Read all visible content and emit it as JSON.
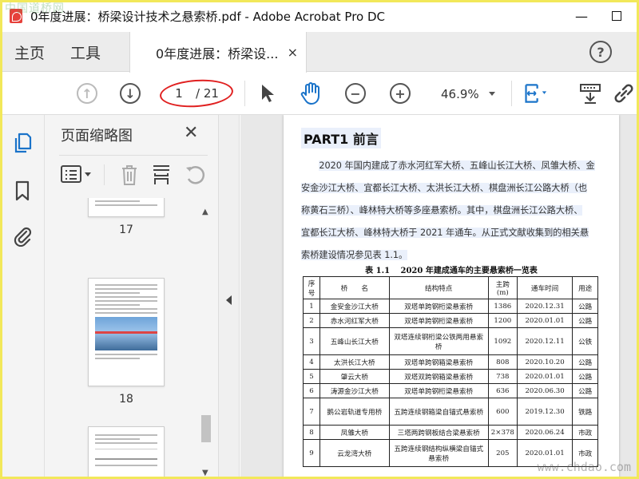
{
  "window": {
    "title": "0年度进展：桥梁设计技术之悬索桥.pdf - Adobe Acrobat Pro DC",
    "minimize": "—",
    "close": "✕"
  },
  "watermarks": {
    "top_left": "中国道桥网",
    "bottom_right": "www.chdao.com"
  },
  "tabs": {
    "home": "主页",
    "tools": "工具",
    "document": "0年度进展：桥梁设...",
    "close": "×",
    "help": "?"
  },
  "toolbar": {
    "page_current": "1",
    "page_total": "/ 21",
    "zoom": "46.9%"
  },
  "panel": {
    "title": "页面缩略图",
    "close": "✕",
    "thumbnails": [
      {
        "label": "17"
      },
      {
        "label": "18"
      }
    ]
  },
  "document": {
    "heading": "PART1 前言",
    "paragraph_lines": [
      "2020 年国内建成了赤水河红军大桥、五峰山长江大桥、凤雏大桥、金",
      "安金沙江大桥、宜都长江大桥、太洪长江大桥、棋盘洲长江公路大桥（也",
      "称黄石三桥）、峰林特大桥等多座悬索桥。其中，棋盘洲长江公路大桥、",
      "宜都长江大桥、峰林特大桥于 2021 年通车。从正式文献收集到的相关悬",
      "索桥建设情况参见表 1.1。"
    ],
    "table_caption": "表 1.1　 2020 年建成通车的主要悬索桥一览表",
    "table_headers": [
      "序号",
      "桥　　名",
      "结构特点",
      "主跨(m)",
      "通车时间",
      "用途"
    ],
    "table_rows": [
      [
        "1",
        "金安金沙江大桥",
        "双塔单跨钢桁梁悬索桥",
        "1386",
        "2020.12.31",
        "公路"
      ],
      [
        "2",
        "赤水河红军大桥",
        "双塔单跨钢桁梁悬索桥",
        "1200",
        "2020.01.01",
        "公路"
      ],
      [
        "3",
        "五峰山长江大桥",
        "双塔连续钢桁梁公铁两用悬索桥",
        "1092",
        "2020.12.11",
        "公铁"
      ],
      [
        "4",
        "太洪长江大桥",
        "双塔单跨钢箱梁悬索桥",
        "808",
        "2020.10.20",
        "公路"
      ],
      [
        "5",
        "肇云大桥",
        "双塔双跨钢箱梁悬索桥",
        "738",
        "2020.01.01",
        "公路"
      ],
      [
        "6",
        "涛源金沙江大桥",
        "双塔单跨钢桁梁悬索桥",
        "636",
        "2020.06.30",
        "公路"
      ],
      [
        "7",
        "鹅公岩轨道专用桥",
        "五跨连续钢箱梁自锚式悬索桥",
        "600",
        "2019.12.30",
        "铁路"
      ],
      [
        "8",
        "凤雏大桥",
        "三塔两跨钢板结合梁悬索桥",
        "2×378",
        "2020.06.24",
        "市政"
      ],
      [
        "9",
        "云龙湾大桥",
        "五跨连续钢结构纵横梁自锚式悬索桥",
        "205",
        "2020.01.01",
        "市政"
      ]
    ]
  }
}
